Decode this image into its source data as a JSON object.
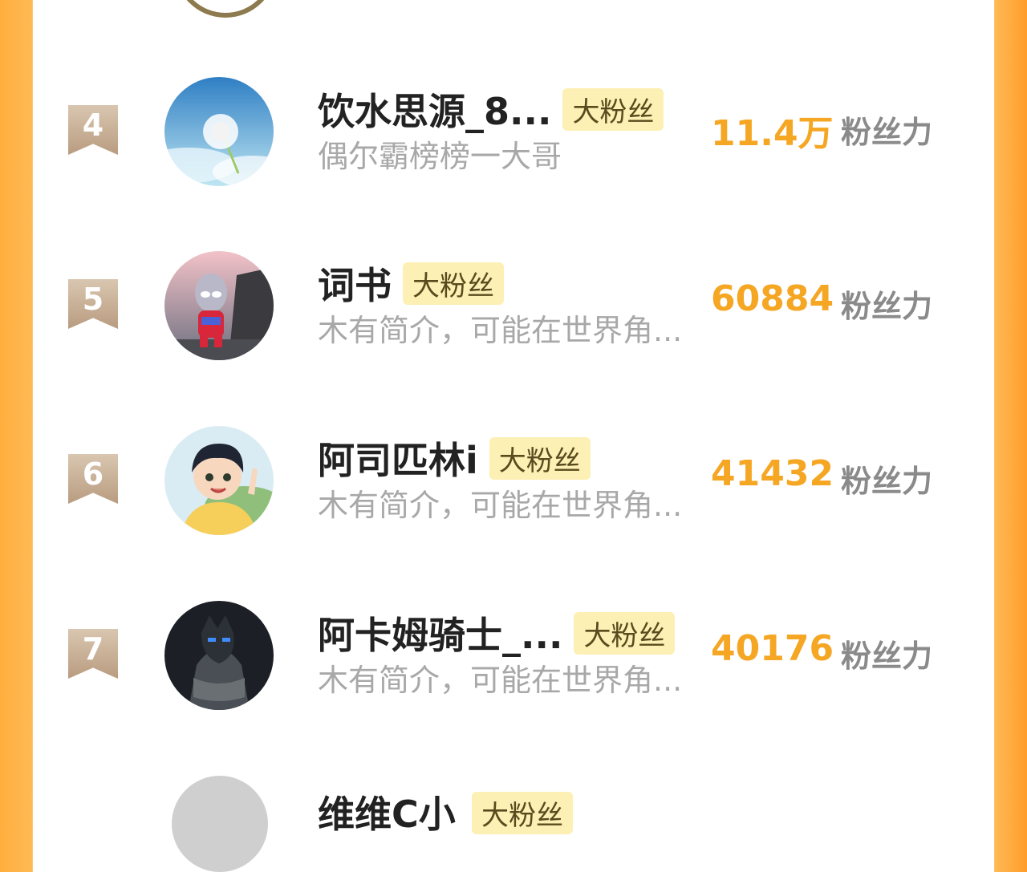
{
  "badge_label": "大粉丝",
  "score_label": "粉丝力",
  "rows": [
    {
      "rank": "4",
      "name": "饮水思源_8...",
      "intro": "偶尔霸榜榜一大哥",
      "score": "11.4万",
      "avatar": "dandelion"
    },
    {
      "rank": "5",
      "name": "词书",
      "intro": "木有简介，可能在世界角...",
      "score": "60884",
      "avatar": "ultraman-figure"
    },
    {
      "rank": "6",
      "name": "阿司匹林i",
      "intro": "木有简介，可能在世界角...",
      "score": "41432",
      "avatar": "anime-boy"
    },
    {
      "rank": "7",
      "name": "阿卡姆骑士_...",
      "intro": "木有简介，可能在世界角...",
      "score": "40176",
      "avatar": "dark-knight"
    }
  ],
  "partial_next_row": {
    "name": "维维C小"
  },
  "colors": {
    "accent": "#f5a623",
    "badge_bg": "#fcf0b4",
    "rank_ribbon": "#c8ad92",
    "side": "#ffae3d"
  }
}
